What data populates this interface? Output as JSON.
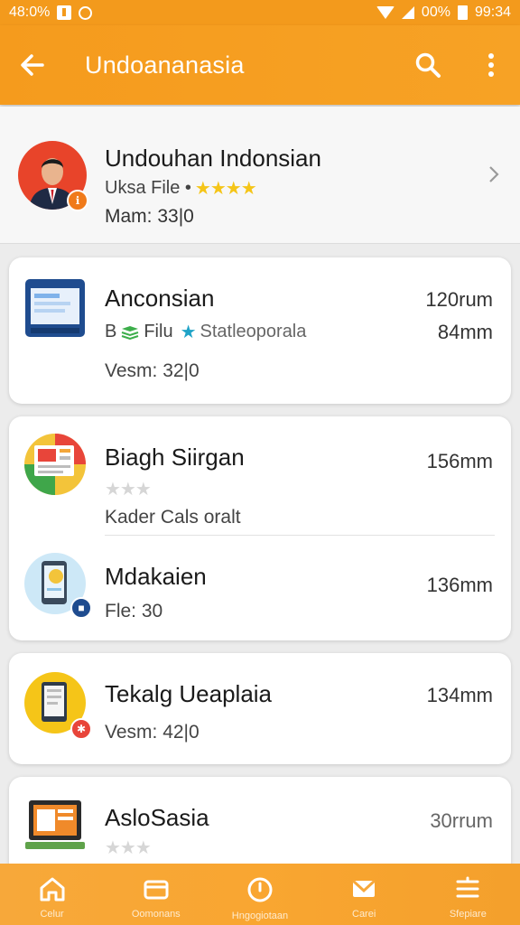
{
  "status_bar": {
    "left_text": "48:0%",
    "right_percent": "00%",
    "time": "99:34"
  },
  "app_bar": {
    "title": "Undoananasia",
    "back_icon": "arrow-left-icon",
    "search_icon": "search-icon",
    "more_icon": "more-vert-icon"
  },
  "featured": {
    "title": "Undouhan Indonsian",
    "subtitle": "Uksa File •",
    "rating_stars": "★★★★",
    "meta": "Mam: 33|0",
    "badge_color": "#f07a1a"
  },
  "cards": [
    {
      "items": [
        {
          "title": "Anconsian",
          "size": "120rum",
          "sub_prefix": "B",
          "sub_file": "Filu",
          "sub_star": "★",
          "sub_text": "Statleoporala",
          "sub_size": "84mm",
          "meta": "Vesm: 32|0"
        }
      ]
    },
    {
      "items": [
        {
          "title": "Biagh Siirgan",
          "size": "156mm",
          "stars": "★★★",
          "meta": "Kader Cals oralt"
        },
        {
          "title": "Mdakaien",
          "size": "136mm",
          "meta": "Fle: 30"
        }
      ]
    },
    {
      "items": [
        {
          "title": "Tekalg Ueaplaia",
          "size": "134mm",
          "meta": "Vesm: 42|0"
        }
      ]
    },
    {
      "items": [
        {
          "title": "AsloSasia",
          "size": "30rrum",
          "stars": "★★★"
        }
      ]
    }
  ],
  "bottom_nav": [
    {
      "label": "Celur",
      "icon": "home-icon"
    },
    {
      "label": "Oomonans",
      "icon": "folder-icon"
    },
    {
      "label": "Hngogiotaan",
      "icon": "clock-icon"
    },
    {
      "label": "Carei",
      "icon": "mail-icon"
    },
    {
      "label": "Sfepiare",
      "icon": "menu-icon"
    }
  ],
  "colors": {
    "accent": "#f59b1d",
    "star": "#f5c518",
    "background": "#ececec"
  }
}
